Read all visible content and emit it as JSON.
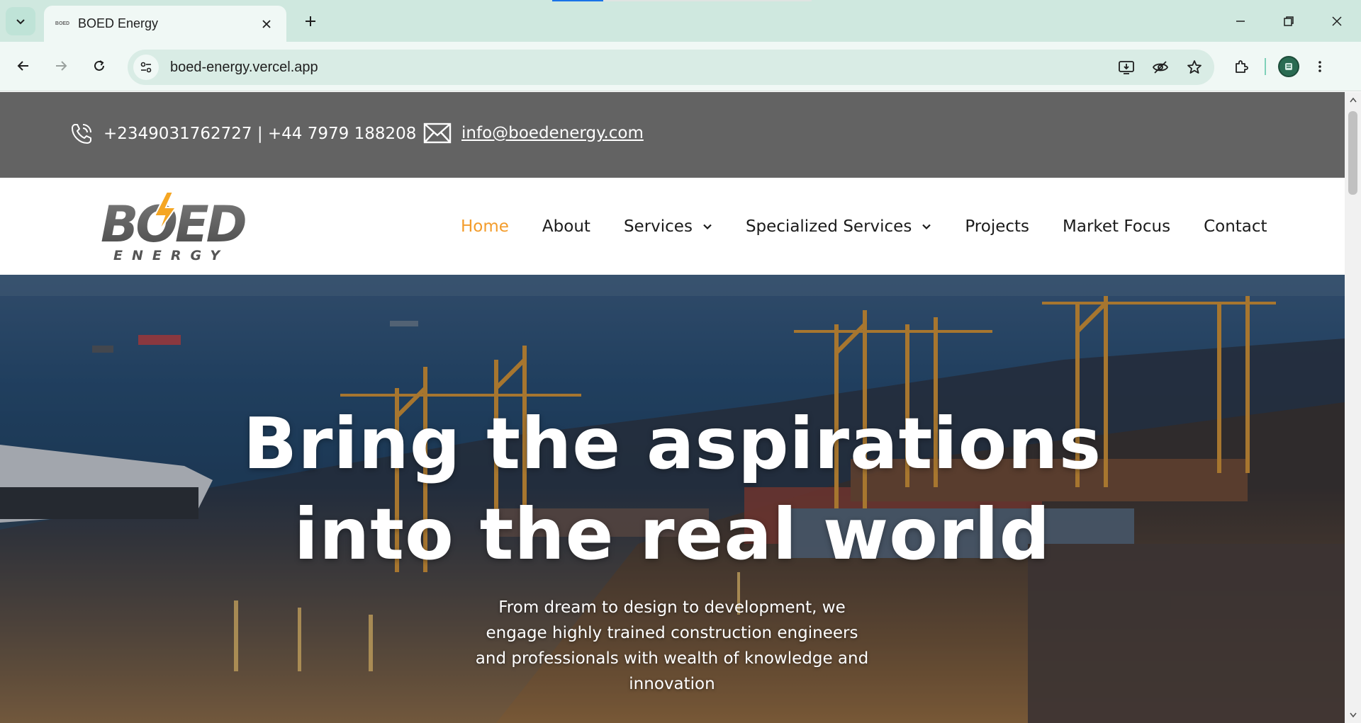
{
  "browser": {
    "tab_title": "BOED Energy",
    "favicon_text": "BOED",
    "url": "boed-energy.vercel.app"
  },
  "topbar": {
    "phone": "+2349031762727 | +44 7979 188208",
    "email": "info@boedenergy.com"
  },
  "logo": {
    "brand": "BOED",
    "tagline": "ENERGY"
  },
  "nav": {
    "items": [
      {
        "label": "Home",
        "active": true,
        "dropdown": false
      },
      {
        "label": "About",
        "active": false,
        "dropdown": false
      },
      {
        "label": "Services",
        "active": false,
        "dropdown": true
      },
      {
        "label": "Specialized Services",
        "active": false,
        "dropdown": true
      },
      {
        "label": "Projects",
        "active": false,
        "dropdown": false
      },
      {
        "label": "Market Focus",
        "active": false,
        "dropdown": false
      },
      {
        "label": "Contact",
        "active": false,
        "dropdown": false
      }
    ]
  },
  "hero": {
    "title_line1": "Bring the aspirations",
    "title_line2": "into the real world",
    "subtitle": "From dream to design to development, we engage highly trained construction engineers and professionals with wealth of knowledge and innovation"
  },
  "colors": {
    "accent": "#f39c2b",
    "topbar_bg": "#636363",
    "chrome_bg": "#cfe8df"
  }
}
